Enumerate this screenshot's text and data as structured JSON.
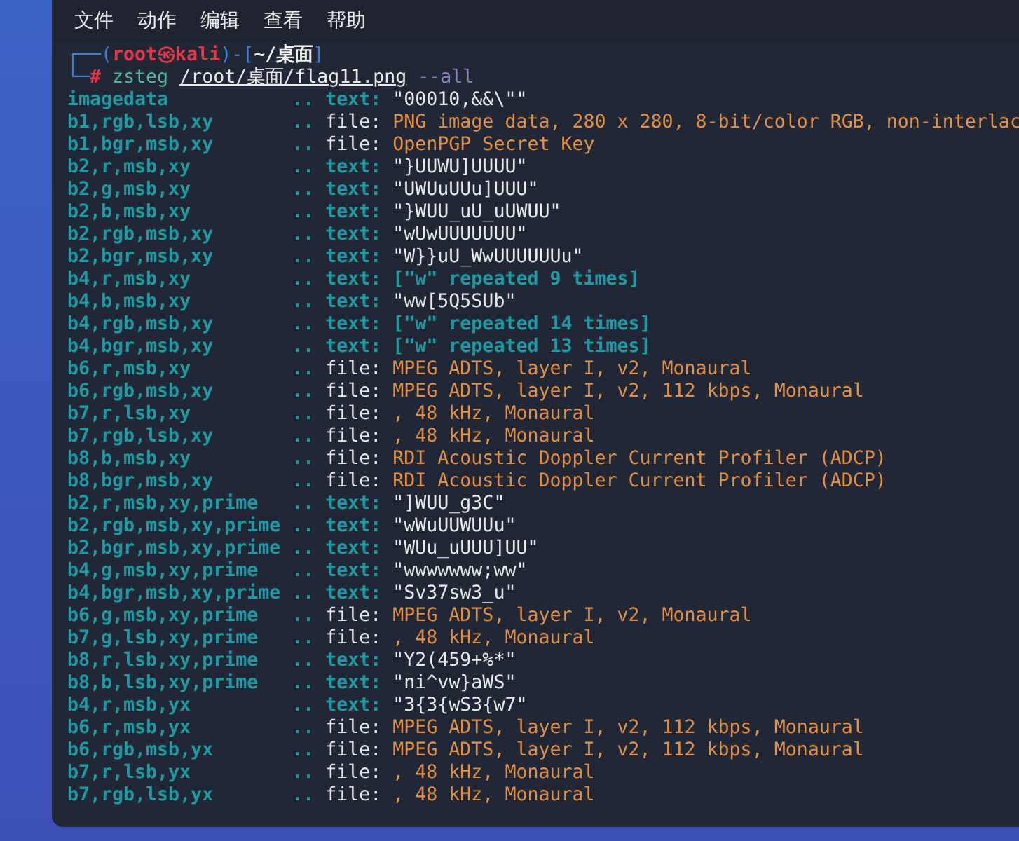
{
  "menu": [
    "文件",
    "动作",
    "编辑",
    "查看",
    "帮助"
  ],
  "prompt": [
    {
      "text": "┌──(",
      "kind": "frame"
    },
    {
      "text": "root㉿kali",
      "kind": "user"
    },
    {
      "text": ")-[",
      "kind": "frame"
    },
    {
      "text": "~/桌面",
      "kind": "dir"
    },
    {
      "text": "]",
      "kind": "frame"
    }
  ],
  "command": [
    {
      "text": "└─",
      "kind": "frame"
    },
    {
      "text": "#",
      "kind": "root"
    },
    {
      "text": "zsteg",
      "kind": "program"
    },
    {
      "text": "/root/桌面/flag11.png",
      "kind": "path"
    },
    {
      "text": "--all",
      "kind": "option"
    }
  ],
  "rows": [
    {
      "name": "imagedata",
      "sep": "..",
      "type": "text:",
      "kind": "text",
      "value": "\"00010,&&\\\"\""
    },
    {
      "name": "b1,rgb,lsb,xy",
      "sep": "..",
      "type": "file:",
      "kind": "file",
      "value": "PNG image data, 280 x 280, 8-bit/color RGB, non-interlac"
    },
    {
      "name": "b1,bgr,msb,xy",
      "sep": "..",
      "type": "file:",
      "kind": "file",
      "value": "OpenPGP Secret Key"
    },
    {
      "name": "b2,r,msb,xy",
      "sep": "..",
      "type": "text:",
      "kind": "text",
      "value": "\"}UUWU]UUUU\""
    },
    {
      "name": "b2,g,msb,xy",
      "sep": "..",
      "type": "text:",
      "kind": "text",
      "value": "\"UWUuUUu]UUU\""
    },
    {
      "name": "b2,b,msb,xy",
      "sep": "..",
      "type": "text:",
      "kind": "text",
      "value": "\"}WUU_uU_uUWUU\""
    },
    {
      "name": "b2,rgb,msb,xy",
      "sep": "..",
      "type": "text:",
      "kind": "text",
      "value": "\"wUwUUUUUUU\""
    },
    {
      "name": "b2,bgr,msb,xy",
      "sep": "..",
      "type": "text:",
      "kind": "text",
      "value": "\"W}}uU_WwUUUUUUu\""
    },
    {
      "name": "b4,r,msb,xy",
      "sep": "..",
      "type": "text:",
      "kind": "repeated",
      "value": "[\"w\" repeated 9 times]"
    },
    {
      "name": "b4,b,msb,xy",
      "sep": "..",
      "type": "text:",
      "kind": "text",
      "value": "\"ww[5Q5SUb\""
    },
    {
      "name": "b4,rgb,msb,xy",
      "sep": "..",
      "type": "text:",
      "kind": "repeated",
      "value": "[\"w\" repeated 14 times]"
    },
    {
      "name": "b4,bgr,msb,xy",
      "sep": "..",
      "type": "text:",
      "kind": "repeated",
      "value": "[\"w\" repeated 13 times]"
    },
    {
      "name": "b6,r,msb,xy",
      "sep": "..",
      "type": "file:",
      "kind": "file",
      "value": "MPEG ADTS, layer I, v2, Monaural"
    },
    {
      "name": "b6,rgb,msb,xy",
      "sep": "..",
      "type": "file:",
      "kind": "file",
      "value": "MPEG ADTS, layer I, v2, 112 kbps, Monaural"
    },
    {
      "name": "b7,r,lsb,xy",
      "sep": "..",
      "type": "file:",
      "kind": "file",
      "value": ", 48 kHz, Monaural"
    },
    {
      "name": "b7,rgb,lsb,xy",
      "sep": "..",
      "type": "file:",
      "kind": "file",
      "value": ", 48 kHz, Monaural"
    },
    {
      "name": "b8,b,msb,xy",
      "sep": "..",
      "type": "file:",
      "kind": "file",
      "value": "RDI Acoustic Doppler Current Profiler (ADCP)"
    },
    {
      "name": "b8,bgr,msb,xy",
      "sep": "..",
      "type": "file:",
      "kind": "file",
      "value": "RDI Acoustic Doppler Current Profiler (ADCP)"
    },
    {
      "name": "b2,r,msb,xy,prime",
      "sep": "..",
      "type": "text:",
      "kind": "text",
      "value": "\"]WUU_g3C\""
    },
    {
      "name": "b2,rgb,msb,xy,prime",
      "sep": "..",
      "type": "text:",
      "kind": "text",
      "value": "\"wWuUUWUUu\""
    },
    {
      "name": "b2,bgr,msb,xy,prime",
      "sep": "..",
      "type": "text:",
      "kind": "text",
      "value": "\"WUu_uUUU]UU\""
    },
    {
      "name": "b4,g,msb,xy,prime",
      "sep": "..",
      "type": "text:",
      "kind": "text",
      "value": "\"wwwwwww;ww\""
    },
    {
      "name": "b4,bgr,msb,xy,prime",
      "sep": "..",
      "type": "text:",
      "kind": "text",
      "value": "\"Sv37sw3_u\""
    },
    {
      "name": "b6,g,msb,xy,prime",
      "sep": "..",
      "type": "file:",
      "kind": "file",
      "value": "MPEG ADTS, layer I, v2, Monaural"
    },
    {
      "name": "b7,g,lsb,xy,prime",
      "sep": "..",
      "type": "file:",
      "kind": "file",
      "value": ", 48 kHz, Monaural"
    },
    {
      "name": "b8,r,lsb,xy,prime",
      "sep": "..",
      "type": "text:",
      "kind": "text",
      "value": "\"Y2(459+%*\""
    },
    {
      "name": "b8,b,lsb,xy,prime",
      "sep": "..",
      "type": "text:",
      "kind": "text",
      "value": "\"ni^vw}aWS\""
    },
    {
      "name": "b4,r,msb,yx",
      "sep": "..",
      "type": "text:",
      "kind": "text",
      "value": "\"3{3{wS3{w7\""
    },
    {
      "name": "b6,r,msb,yx",
      "sep": "..",
      "type": "file:",
      "kind": "file",
      "value": "MPEG ADTS, layer I, v2, 112 kbps, Monaural"
    },
    {
      "name": "b6,rgb,msb,yx",
      "sep": "..",
      "type": "file:",
      "kind": "file",
      "value": "MPEG ADTS, layer I, v2, 112 kbps, Monaural"
    },
    {
      "name": "b7,r,lsb,yx",
      "sep": "..",
      "type": "file:",
      "kind": "file",
      "value": ", 48 kHz, Monaural"
    },
    {
      "name": "b7,rgb,lsb,yx",
      "sep": "..",
      "type": "file:",
      "kind": "file",
      "value": ", 48 kHz, Monaural"
    }
  ]
}
